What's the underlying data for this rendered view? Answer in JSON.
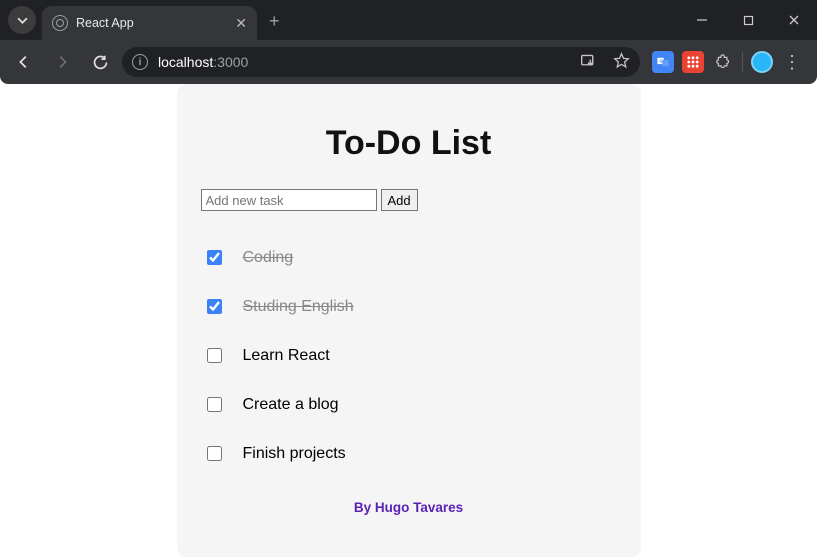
{
  "browser": {
    "tab_title": "React App",
    "url_host": "localhost",
    "url_port": ":3000"
  },
  "app": {
    "title": "To-Do List",
    "input_placeholder": "Add new task",
    "add_button": "Add",
    "footer": "By Hugo Tavares",
    "tasks": [
      {
        "label": "Coding",
        "done": true
      },
      {
        "label": "Studing English",
        "done": true
      },
      {
        "label": "Learn React",
        "done": false
      },
      {
        "label": "Create a blog",
        "done": false
      },
      {
        "label": "Finish projects",
        "done": false
      }
    ]
  }
}
